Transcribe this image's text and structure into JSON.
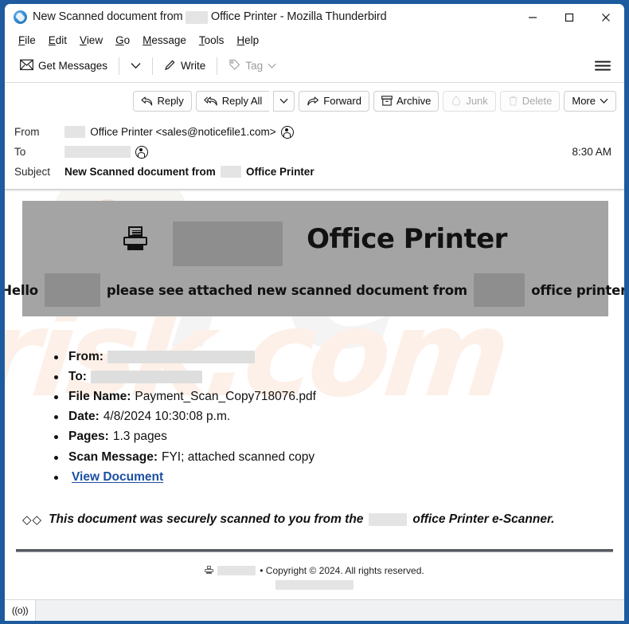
{
  "window": {
    "title_before": "New Scanned document from",
    "title_redacted": "       ",
    "title_after": "Office Printer - Mozilla Thunderbird",
    "app_icon": "thunderbird-icon",
    "minimize_label": "─",
    "maximize_label": "☐",
    "close_label": "✕"
  },
  "menubar": {
    "items": [
      {
        "label": "File",
        "accel": "F"
      },
      {
        "label": "Edit",
        "accel": "E"
      },
      {
        "label": "View",
        "accel": "V"
      },
      {
        "label": "Go",
        "accel": "G"
      },
      {
        "label": "Message",
        "accel": "M"
      },
      {
        "label": "Tools",
        "accel": "T"
      },
      {
        "label": "Help",
        "accel": "H"
      }
    ]
  },
  "toolbar": {
    "get_messages": "Get Messages",
    "write": "Write",
    "tag": "Tag",
    "app_menu": "app-menu"
  },
  "message_actions": {
    "reply": "Reply",
    "reply_all": "Reply All",
    "forward": "Forward",
    "archive": "Archive",
    "junk": "Junk",
    "delete": "Delete",
    "more": "More"
  },
  "headers": {
    "from_label": "From",
    "from_redacted": "       ",
    "from_value": "Office Printer <sales@noticefile1.com>",
    "to_label": "To",
    "to_redacted": "                      ",
    "time": "8:30 AM",
    "subject_label": "Subject",
    "subject_before": "New Scanned document from",
    "subject_redacted": "       ",
    "subject_after": "Office Printer"
  },
  "email": {
    "banner": {
      "icon": "printer-icon",
      "brand_redacted": "               ",
      "title": "Office Printer",
      "greeting": "Hello",
      "name_redacted": "         ",
      "sub_mid": "please see attached new scanned document from",
      "company_redacted": "        ",
      "sub_end": "office printer."
    },
    "details": [
      {
        "label": "From:",
        "value": "",
        "redacted": "                               "
      },
      {
        "label": "To:",
        "value": "",
        "redacted": "                       "
      },
      {
        "label": "File Name:",
        "value": "Payment_Scan_Copy718076.pdf",
        "redacted": ""
      },
      {
        "label": "Date:",
        "value": "4/8/2024 10:30:08 p.m.",
        "redacted": ""
      },
      {
        "label": "Pages:",
        "value": "1.3 pages",
        "redacted": ""
      },
      {
        "label": "Scan Message:",
        "value": "FYI; attached scanned copy",
        "redacted": ""
      }
    ],
    "link_text": "View Document",
    "notice": {
      "bullets": "◇◇",
      "before": "This document was securely scanned to you from the",
      "redacted": "        ",
      "after": "office Printer e-Scanner."
    },
    "footer": {
      "icon": "printer-icon",
      "brand_redacted": "       ",
      "copyright": "• Copyright © 2024. All rights reserved.",
      "sub_redacted": "                        "
    },
    "watermark": {
      "top": "PC",
      "bottom": "risk.com"
    }
  },
  "statusbar": {
    "connection_icon": "((o))"
  },
  "colors": {
    "window_frame": "#1d5b9e",
    "banner_gray": "#a4a4a4",
    "link_blue": "#1b4fa0",
    "redaction_gray": "#e4e4e4"
  }
}
